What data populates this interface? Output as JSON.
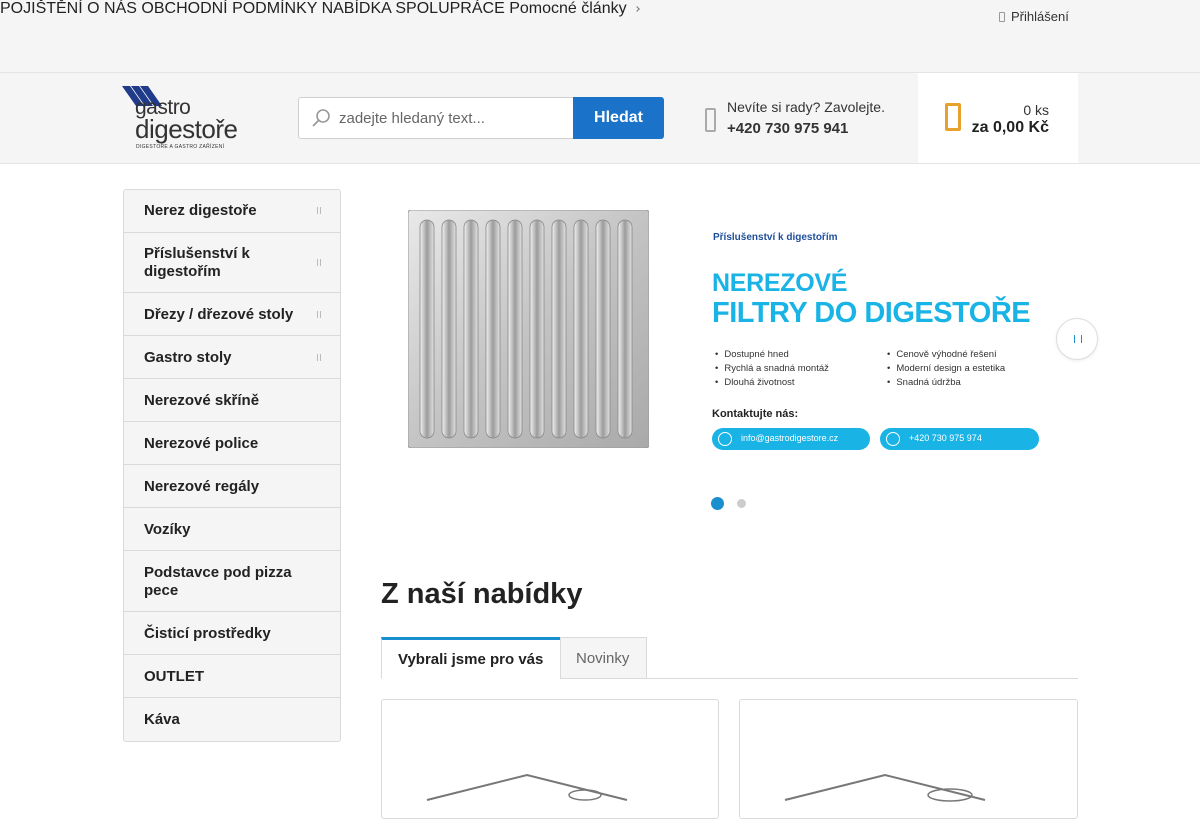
{
  "topnav": {
    "items": [
      "POJIŠTĚNÍ",
      "O NÁS",
      "OBCHODNÍ PODMÍNKY",
      "NABÍDKA SPOLUPRÁCE"
    ],
    "more_label": "Pomocné články",
    "login_label": "Přihlášení"
  },
  "logo": {
    "line1": "gastro",
    "line2": "digestoře",
    "sub": "DIGESTOŘE A GASTRO ZAŘÍZENÍ"
  },
  "search": {
    "placeholder": "zadejte hledaný text...",
    "button_label": "Hledat"
  },
  "contact": {
    "text": "Nevíte si rady? Zavolejte.",
    "phone": "+420 730 975 941"
  },
  "cart": {
    "count": "0 ks",
    "total": "za 0,00 Kč"
  },
  "sidebar": {
    "items": [
      {
        "label": "Nerez digestoře",
        "has_sub": true
      },
      {
        "label": "Příslušenství k digestořím",
        "has_sub": true
      },
      {
        "label": "Dřezy / dřezové stoly",
        "has_sub": true
      },
      {
        "label": "Gastro stoly",
        "has_sub": true
      },
      {
        "label": "Nerezové skříně",
        "has_sub": false
      },
      {
        "label": "Nerezové police",
        "has_sub": false
      },
      {
        "label": "Nerezové regály",
        "has_sub": false
      },
      {
        "label": "Vozíky",
        "has_sub": false
      },
      {
        "label": "Podstavce pod pizza pece",
        "has_sub": false
      },
      {
        "label": "Čisticí prostředky",
        "has_sub": false
      },
      {
        "label": "OUTLET",
        "has_sub": false
      },
      {
        "label": "Káva",
        "has_sub": false
      }
    ]
  },
  "banner": {
    "kicker": "Příslušenství k digestořím",
    "headline1": "NEREZOVÉ",
    "headline2": "FILTRY DO DIGESTOŘE",
    "features_left": [
      "Dostupné hned",
      "Rychlá a snadná montáž",
      "Dlouhá životnost"
    ],
    "features_right": [
      "Cenově výhodné řešení",
      "Moderní design a estetika",
      "Snadná údržba"
    ],
    "contact_label": "Kontaktujte nás:",
    "email": "info@gastrodigestore.cz",
    "phone": "+420 730 975 974",
    "slide_count": 2,
    "active_slide": 1
  },
  "offer": {
    "title": "Z naší nabídky",
    "tabs": [
      {
        "label": "Vybrali jsme pro vás",
        "active": true
      },
      {
        "label": "Novinky",
        "active": false
      }
    ]
  },
  "colors": {
    "primary": "#1a73c8",
    "accent": "#1a8fd0",
    "banner_cyan": "#19b3e6",
    "cart_icon": "#e8a12c",
    "topbar_bg": "#f5f5f5"
  }
}
